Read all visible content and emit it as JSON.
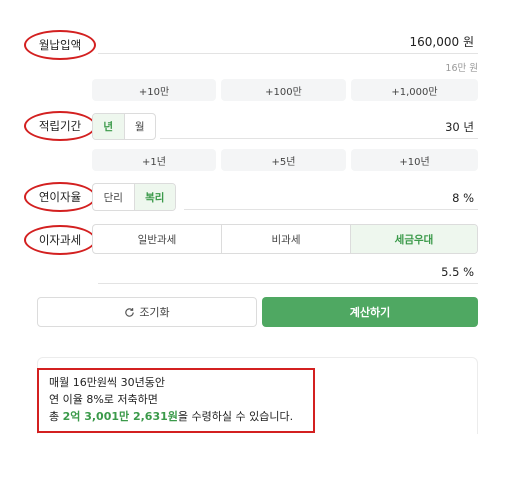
{
  "monthly": {
    "label": "월납입액",
    "amount": "160,000",
    "unit": "원",
    "hint": "16만 원",
    "quick": [
      "+10만",
      "+100만",
      "+1,000만"
    ]
  },
  "period": {
    "label": "적립기간",
    "options": [
      "년",
      "월"
    ],
    "selected": "년",
    "value": "30",
    "unit": "년",
    "quick": [
      "+1년",
      "+5년",
      "+10년"
    ]
  },
  "rate": {
    "label": "연이자율",
    "options": [
      "단리",
      "복리"
    ],
    "selected": "복리",
    "value": "8",
    "unit": "%"
  },
  "tax": {
    "label": "이자과세",
    "options": [
      "일반과세",
      "비과세",
      "세금우대"
    ],
    "selected": "세금우대",
    "value": "5.5",
    "unit": "%"
  },
  "actions": {
    "reset_label": "조기화",
    "calc_label": "계산하기"
  },
  "result": {
    "line1": "매월 16만원씩 30년동안",
    "line2": "연 이율 8%로 저축하면",
    "line3_prefix": "총 ",
    "total": "2억 3,001만 2,631원",
    "line3_suffix": "을 수령하실 수 있습니다."
  },
  "colors": {
    "accent": "#4fa862",
    "highlight_border": "#d32020"
  }
}
